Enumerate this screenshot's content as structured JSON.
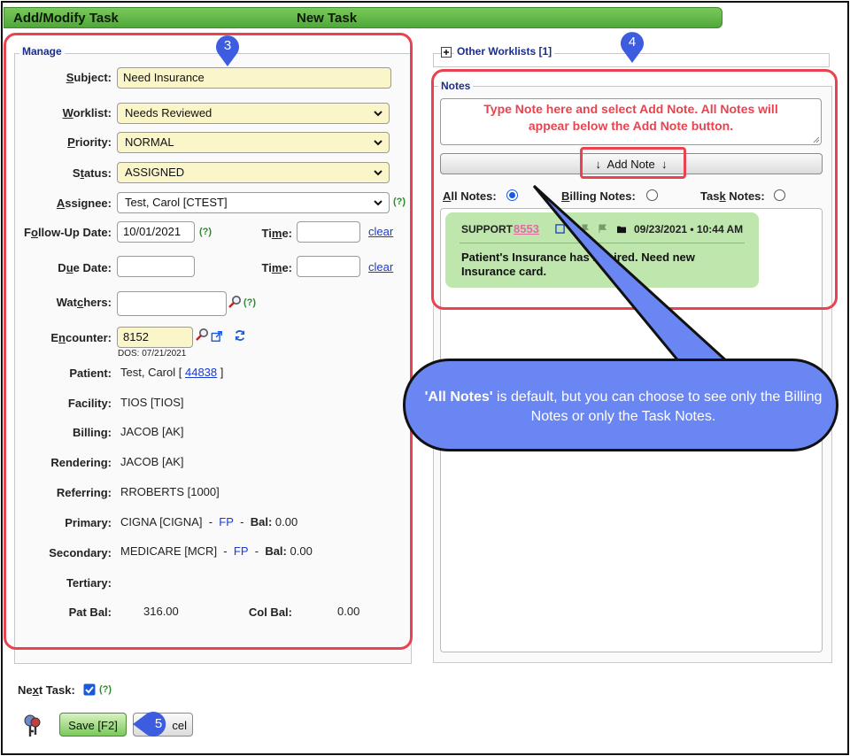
{
  "header": {
    "title": "Add/Modify Task",
    "subtitle": "New Task"
  },
  "manage": {
    "legend": "Manage",
    "subject": {
      "label": "Subject:",
      "value": "Need Insurance"
    },
    "worklist": {
      "label": "Worklist:",
      "value": "Needs Reviewed"
    },
    "priority": {
      "label": "Priority:",
      "value": "NORMAL"
    },
    "status": {
      "label": "Status:",
      "value": "ASSIGNED"
    },
    "assignee": {
      "label": "Assignee:",
      "value": "Test, Carol [CTEST]",
      "help": "(?)"
    },
    "followup": {
      "label": "Follow-Up Date:",
      "value": "10/01/2021",
      "help": "(?)",
      "time_label": "Time:",
      "clear": "clear"
    },
    "due": {
      "label": "Due Date:",
      "value": "",
      "time_label": "Time:",
      "clear": "clear"
    },
    "watchers": {
      "label": "Watchers:",
      "value": "",
      "help": "(?)"
    },
    "encounter": {
      "label": "Encounter:",
      "value": "8152",
      "dos": "DOS: 07/21/2021"
    },
    "patient": {
      "label": "Patient:",
      "value": "Test, Carol [",
      "link": "44838",
      "close": "]"
    },
    "facility": {
      "label": "Facility:",
      "value": "TIOS [TIOS]"
    },
    "billing": {
      "label": "Billing:",
      "value": "JACOB [AK]"
    },
    "rendering": {
      "label": "Rendering:",
      "value": "JACOB [AK]"
    },
    "referring": {
      "label": "Referring:",
      "value": "RROBERTS [1000]"
    },
    "primary": {
      "label": "Primary:",
      "value": "CIGNA [CIGNA]",
      "sep": "-",
      "fp": "FP",
      "bal_label": "Bal:",
      "bal": "0.00"
    },
    "secondary": {
      "label": "Secondary:",
      "value": "MEDICARE [MCR]",
      "sep": "-",
      "fp": "FP",
      "bal_label": "Bal:",
      "bal": "0.00"
    },
    "tertiary": {
      "label": "Tertiary:"
    },
    "patbal": {
      "label": "Pat Bal:",
      "value": "316.00"
    },
    "colbal": {
      "label": "Col Bal:",
      "value": "0.00"
    }
  },
  "worklists": {
    "legend": "Other Worklists [1]"
  },
  "notes": {
    "legend": "Notes",
    "hint": "Type Note here and select Add Note. All Notes will appear below the Add Note button.",
    "add_button": "Add Note",
    "filters": {
      "all": "All Notes:",
      "billing": "Billing Notes:",
      "task": "Task Notes:"
    },
    "card": {
      "tag": "SUPPORT",
      "number": "8553",
      "datetime": "09/23/2021 • 10:44 AM",
      "text": "Patient's Insurance has Expired. Need new Insurance card."
    }
  },
  "callout": {
    "text_bold": "'All Notes'",
    "text_rest": " is default, but you can choose to see only the Billing Notes or only the Task Notes."
  },
  "markers": {
    "m3": "3",
    "m4": "4",
    "m5": "5"
  },
  "footer": {
    "next_task": "Next Task:",
    "help": "(?)",
    "save": "Save [F2]",
    "cancel": "cel"
  },
  "colors": {
    "red": "#e8434f",
    "green": "#5aad3d",
    "blue": "#3d5ce0"
  }
}
